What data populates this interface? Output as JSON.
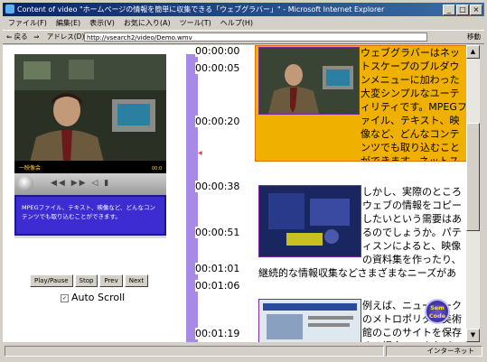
{
  "window": {
    "title": "Content of video \"ホームページの情報を簡単に収集できる「ウェブグラバー」\" - Microsoft Internet Explorer",
    "controls": [
      "_",
      "□",
      "×"
    ]
  },
  "menu": [
    "ファイル(F)",
    "編集(E)",
    "表示(V)",
    "お気に入り(A)",
    "ツール(T)",
    "ヘルプ(H)"
  ],
  "toolbar": {
    "back_label": "⇐ 戻る",
    "forward_label": "⇒",
    "address_label": "アドレス(D)",
    "address_value": "http://vsearch2/video/Demo.wmv",
    "go_label": "移動"
  },
  "status": {
    "zone": "インターネット"
  },
  "player": {
    "subtitle": "MPEGファイル、テキスト、映像など、どんなコンテンツでも取り込むことができます。",
    "buttons": [
      "Play/Pause",
      "Stop",
      "Prev",
      "Next"
    ],
    "autoscroll_label": "Auto Scroll"
  },
  "timeline": {
    "timestamps": [
      "00:00:00",
      "00:00:05",
      "00:00:20",
      "00:00:38",
      "00:00:51",
      "00:01:01",
      "00:01:06",
      "00:01:19"
    ]
  },
  "segments": [
    {
      "text": "ウェブグラバーはネットスケープのブルダウンメニューに加わった大変シンプルなユーティリティです。MPEGファイル、テキスト、映像など、どんなコンテンツでも取り込むことができます。ネットスケープから保存したものはすべてCD−Rに書きこめます。"
    },
    {
      "text": "しかし、実際のところウェブの情報をコピーしたいという需要はあるのでしょうか。パティスンによると、映像の資料集を作ったり、継続的な情報収集などさまざまなニーズがあるということです。"
    },
    {
      "text": "例えば、ニューヨークのメトロポリタン美術館のこのサイトを保存する場合、モネなど"
    }
  ],
  "badge": {
    "text": "Sem\nCode"
  }
}
